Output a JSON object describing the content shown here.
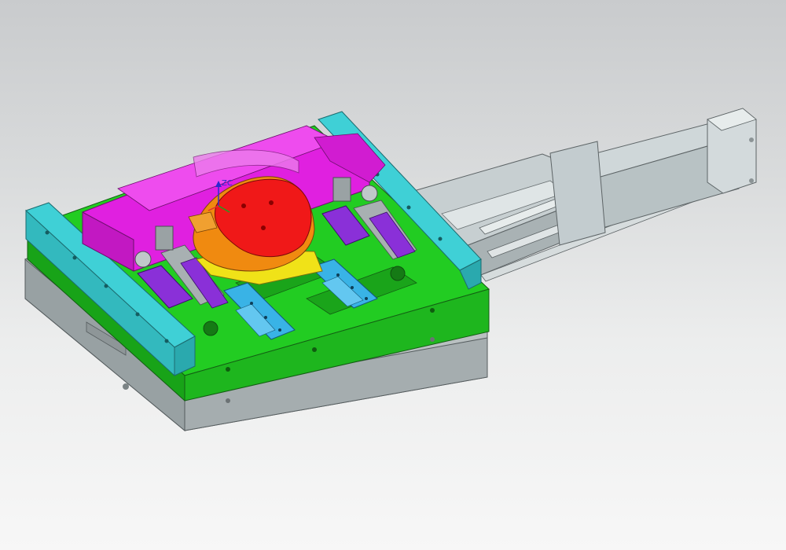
{
  "viewport": {
    "background_top": "#c9cbcd",
    "background_bottom": "#f7f7f7"
  },
  "wcs": {
    "axis_label": "ZC",
    "axis_color": "#2a2ad0"
  },
  "model": {
    "plate_gray": "#b9c0c1",
    "plate_green": "#22cc22",
    "rail_cyan": "#3fd0d6",
    "core_magenta": "#e020e0",
    "slider_purple": "#8a30d8",
    "insert_blue": "#39b3e6",
    "part_red": "#f01818",
    "part_orange": "#f08a10",
    "part_yellow": "#f0e218",
    "cylinder_metal": "#c9d2d4"
  }
}
